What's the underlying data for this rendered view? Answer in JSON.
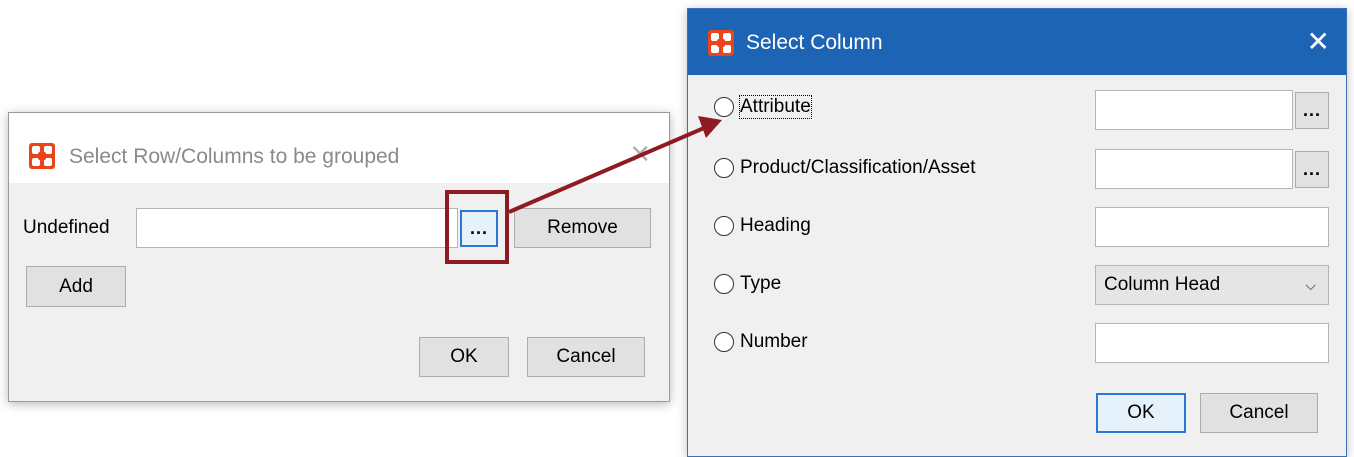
{
  "left_dialog": {
    "title": "Select Row/Columns to be grouped",
    "close_glyph": "✕",
    "field_label": "Undefined",
    "field_value": "",
    "browse_label": "...",
    "remove_label": "Remove",
    "add_label": "Add",
    "ok_label": "OK",
    "cancel_label": "Cancel"
  },
  "right_dialog": {
    "title": "Select Column",
    "close_glyph": "✕",
    "options": [
      {
        "label": "Attribute",
        "value": "",
        "browse_label": "..."
      },
      {
        "label": "Product/Classification/Asset",
        "value": "",
        "browse_label": "..."
      },
      {
        "label": "Heading",
        "value": ""
      },
      {
        "label": "Type",
        "selected": "Column Head",
        "chevron": "⌵"
      },
      {
        "label": "Number",
        "value": ""
      }
    ],
    "ok_label": "OK",
    "cancel_label": "Cancel"
  },
  "colors": {
    "titlebar_blue": "#1e64b4",
    "highlight_red": "#8e1b22",
    "app_icon": "#e8451d"
  },
  "icons": {
    "app_icon": "app-logo-icon",
    "arrow": "annotation-arrow"
  }
}
